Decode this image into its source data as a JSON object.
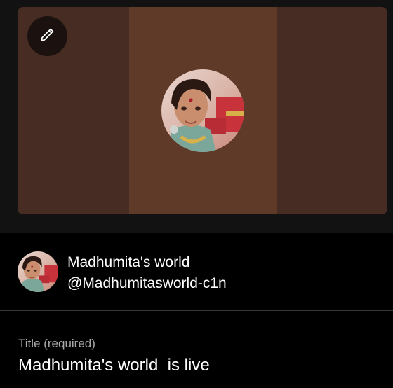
{
  "preview": {
    "edit_icon": "pencil-icon",
    "background_color": "#462c22",
    "center_color": "#5f3a29"
  },
  "channel": {
    "name": "Madhumita's world",
    "handle": "@Madhumitasworld-c1n",
    "avatar_icon": "channel-avatar"
  },
  "title_field": {
    "label": "Title (required)",
    "value": "Madhumita's world  is live"
  }
}
